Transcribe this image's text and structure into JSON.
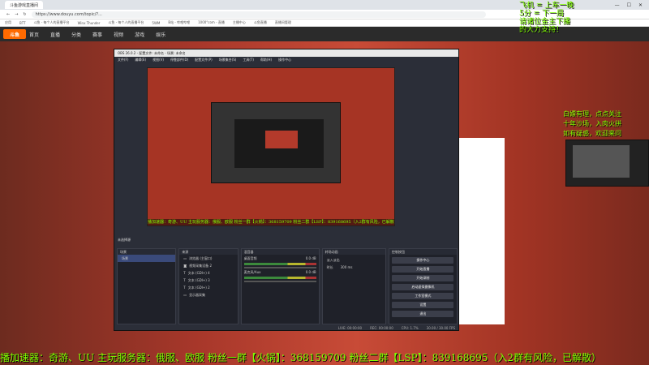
{
  "browser": {
    "tab_title": "斗鱼游戏直播间",
    "url": "https://www.douyu.com/topic/?...",
    "bookmarks": [
      "应用",
      "BTT",
      "斗鱼 - 每个人的直播平台",
      "Winx Thunder",
      "斗鱼 - 每个人的直播平台",
      "5WM",
      "B站 - 哔哩哔哩",
      "1000°com - 直播",
      "主播中心",
      "斗鱼直播",
      "直播间管理"
    ],
    "window_controls": [
      "—",
      "☐",
      "✕"
    ]
  },
  "site": {
    "logo": "斗鱼",
    "nav": [
      "首页",
      "直播",
      "分类",
      "赛事",
      "视频",
      "游戏",
      "娱乐"
    ]
  },
  "obs": {
    "title": "OBS 26.0.2 - 配置文件: 未命名 - 场景: 未命名",
    "menu": [
      "文件(F)",
      "编辑(E)",
      "视图(V)",
      "停靠部件(D)",
      "配置文件(P)",
      "场景集合(S)",
      "工具(T)",
      "帮助(H)",
      "操作中心"
    ],
    "preview_ticker": "播加速器：奇游、UU 主玩服务器：俄服、欧服 粉丝一群【火锅】：368159709 粉丝二群【LSP】：839168695（入2群有风险，已解散）",
    "scene_label": "未选择源",
    "docks": {
      "scenes": {
        "title": "场景",
        "items": [
          "场景"
        ]
      },
      "sources": {
        "title": "来源",
        "items": [
          "浏览器 (主窗口)",
          "视频采集设备 2",
          "文本 (GDI+) 4",
          "文本 (GDI+) 3",
          "文本 (GDI+) 2",
          "显示器采集"
        ]
      },
      "mixer": {
        "title": "混音器",
        "channels": [
          {
            "name": "桌面音频",
            "level": "0.0 dB"
          },
          {
            "name": "麦克风/Aux",
            "level": "0.0 dB"
          }
        ]
      },
      "transitions": {
        "title": "转场动画",
        "type": "淡入淡出",
        "duration_label": "时长",
        "duration": "300 ms"
      },
      "controls": {
        "title": "控制按钮",
        "buttons": [
          "操作中心",
          "开始直播",
          "开始录制",
          "启动虚拟摄像机",
          "工作室模式",
          "设置",
          "退出"
        ]
      }
    },
    "status": {
      "live": "LIVE: 00:00:00",
      "rec": "REC: 00:00:00",
      "cpu": "CPU: 1.7%",
      "fps": "30.00 / 30.00 FPS"
    }
  },
  "overlay": {
    "top_right_lines": [
      "飞机 = 上车一晚",
      "5分 = 下一局",
      "请诸位金主下播",
      "的大力支持！"
    ],
    "right_lines": [
      "白嫖有理，点点关注",
      "十年沙场，入肉火拼",
      "如有疑惑，欢迎来问"
    ],
    "bottom_ticker": "播加速器：奇游、UU  主玩服务器：俄服、欧服  粉丝一群【火锅】：368159709  粉丝二群【LSP】：839168695（入2群有风险，已解散）"
  }
}
